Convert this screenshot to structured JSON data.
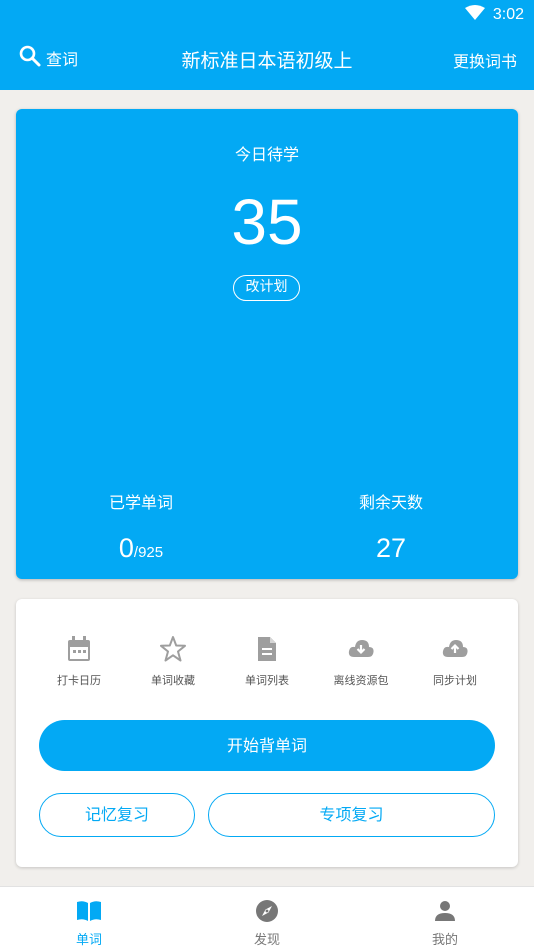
{
  "status_bar": {
    "time": "3:02",
    "wifi_icon": "wifi-icon"
  },
  "toolbar": {
    "search_label": "查词",
    "title": "新标准日本语初级上",
    "change_book_label": "更换词书"
  },
  "plan": {
    "today_label": "今日待学",
    "today_count": "35",
    "change_plan_label": "改计划",
    "learned_label": "已学单词",
    "learned_value": "0",
    "learned_total": "/925",
    "days_label": "剩余天数",
    "days_value": "27"
  },
  "tools": [
    {
      "label": "打卡日历",
      "icon": "calendar-icon"
    },
    {
      "label": "单词收藏",
      "icon": "star-icon"
    },
    {
      "label": "单词列表",
      "icon": "document-icon"
    },
    {
      "label": "离线资源包",
      "icon": "cloud-download-icon"
    },
    {
      "label": "同步计划",
      "icon": "cloud-upload-icon"
    }
  ],
  "actions": {
    "start_label": "开始背单词",
    "memory_review_label": "记忆复习",
    "special_review_label": "专项复习"
  },
  "bottom_nav": [
    {
      "label": "单词",
      "icon": "book-icon",
      "active": true
    },
    {
      "label": "发现",
      "icon": "compass-icon",
      "active": false
    },
    {
      "label": "我的",
      "icon": "person-icon",
      "active": false
    }
  ],
  "colors": {
    "primary": "#03a9f4",
    "background": "#f1efec",
    "icon_gray": "#9e9e9e"
  }
}
